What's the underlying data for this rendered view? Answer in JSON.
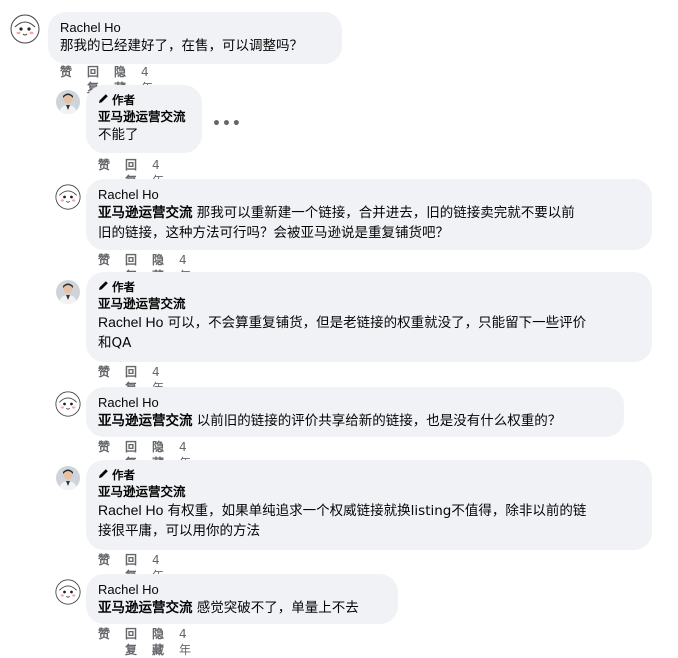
{
  "actions": {
    "like": "赞",
    "reply": "回复",
    "hide": "隐藏",
    "time": "4年"
  },
  "author_badge": "作者",
  "page_name": "亚马逊运营交流",
  "commenter_name": "Rachel Ho",
  "more_label": "•••",
  "comments": [
    {
      "id": "c1",
      "text": "那我的已经建好了，在售，可以调整吗？"
    },
    {
      "id": "c2",
      "text": "不能了"
    },
    {
      "id": "c3",
      "line1": "那我可以重新建一个链接，合并进去，旧的链接卖完就不要以前",
      "line2": "旧的链接，这种方法可行吗？会被亚马逊说是重复铺货吧？"
    },
    {
      "id": "c4",
      "line1": "可以，不会算重复铺货，但是老链接的权重就没了，只能留下一些评价",
      "line2": "和QA"
    },
    {
      "id": "c5",
      "text": "以前旧的链接的评价共享给新的链接，也是没有什么权重的？"
    },
    {
      "id": "c6",
      "line1": "有权重，如果单纯追求一个权威链接就换listing不值得，除非以前的链",
      "line2": "接很平庸，可以用你的方法"
    },
    {
      "id": "c7",
      "text": "感觉突破不了，单量上不去"
    }
  ]
}
